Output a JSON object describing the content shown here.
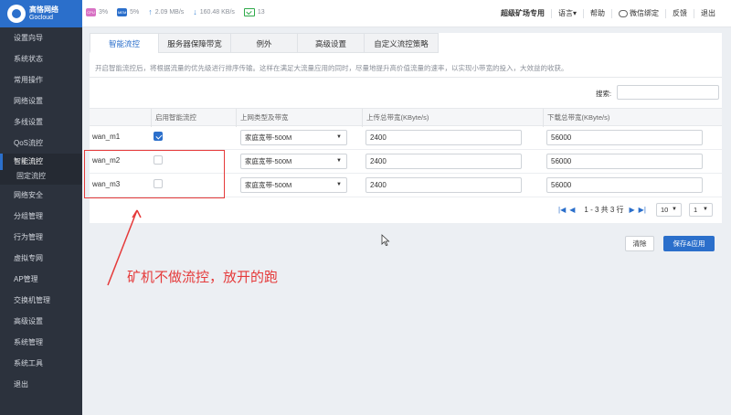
{
  "brand": {
    "name_cn": "高恪网络",
    "name_en": "Gocloud"
  },
  "status": {
    "cpu_chip": "CPU",
    "cpu": "3%",
    "mem_chip": "MEM",
    "mem": "5%",
    "upload": "2.09 MB/s",
    "download": "160.48 KB/s",
    "online": "13"
  },
  "topnav": [
    "超级矿场专用",
    "语言▾",
    "帮助",
    "微信绑定",
    "反馈",
    "退出"
  ],
  "sidebar": {
    "items": [
      "设置向导",
      "系统状态",
      "常用操作",
      "网络设置",
      "多线设置",
      "QoS流控",
      "智能流控",
      "固定流控",
      "网络安全",
      "分组管理",
      "行为管理",
      "虚拟专网",
      "AP管理",
      "交换机管理",
      "高级设置",
      "系统管理",
      "系统工具",
      "退出"
    ]
  },
  "tabs": [
    "智能流控",
    "服务器保障带宽",
    "例外",
    "高级设置",
    "自定义流控策略"
  ],
  "description": "开启智能流控后，将根据流量的优先级进行排序传输。这样在满足大流量应用的同时，尽量地提升高价值流量的速率，以实现小带宽的投入，大效益的收获。",
  "search_label": "搜索:",
  "table": {
    "headers": [
      "启用智能流控",
      "上网类型及带宽",
      "上传总带宽(KByte/s)",
      "下载总带宽(KByte/s)"
    ],
    "rows": [
      {
        "name": "wan_m1",
        "enabled": true,
        "type": "家庭宽带-500M",
        "upload": "2400",
        "download": "56000"
      },
      {
        "name": "wan_m2",
        "enabled": false,
        "type": "家庭宽带-500M",
        "upload": "2400",
        "download": "56000"
      },
      {
        "name": "wan_m3",
        "enabled": false,
        "type": "家庭宽带-500M",
        "upload": "2400",
        "download": "56000"
      }
    ]
  },
  "pagination": {
    "range": "1 - 3 共 3 行",
    "page_size": "10",
    "page": "1"
  },
  "buttons": {
    "clear": "清除",
    "save": "保存&应用"
  },
  "annotation": "矿机不做流控，放开的跑",
  "colors": {
    "accent": "#2b6fcb",
    "sidebar": "#2c323d",
    "annotation": "#e53a3a"
  }
}
